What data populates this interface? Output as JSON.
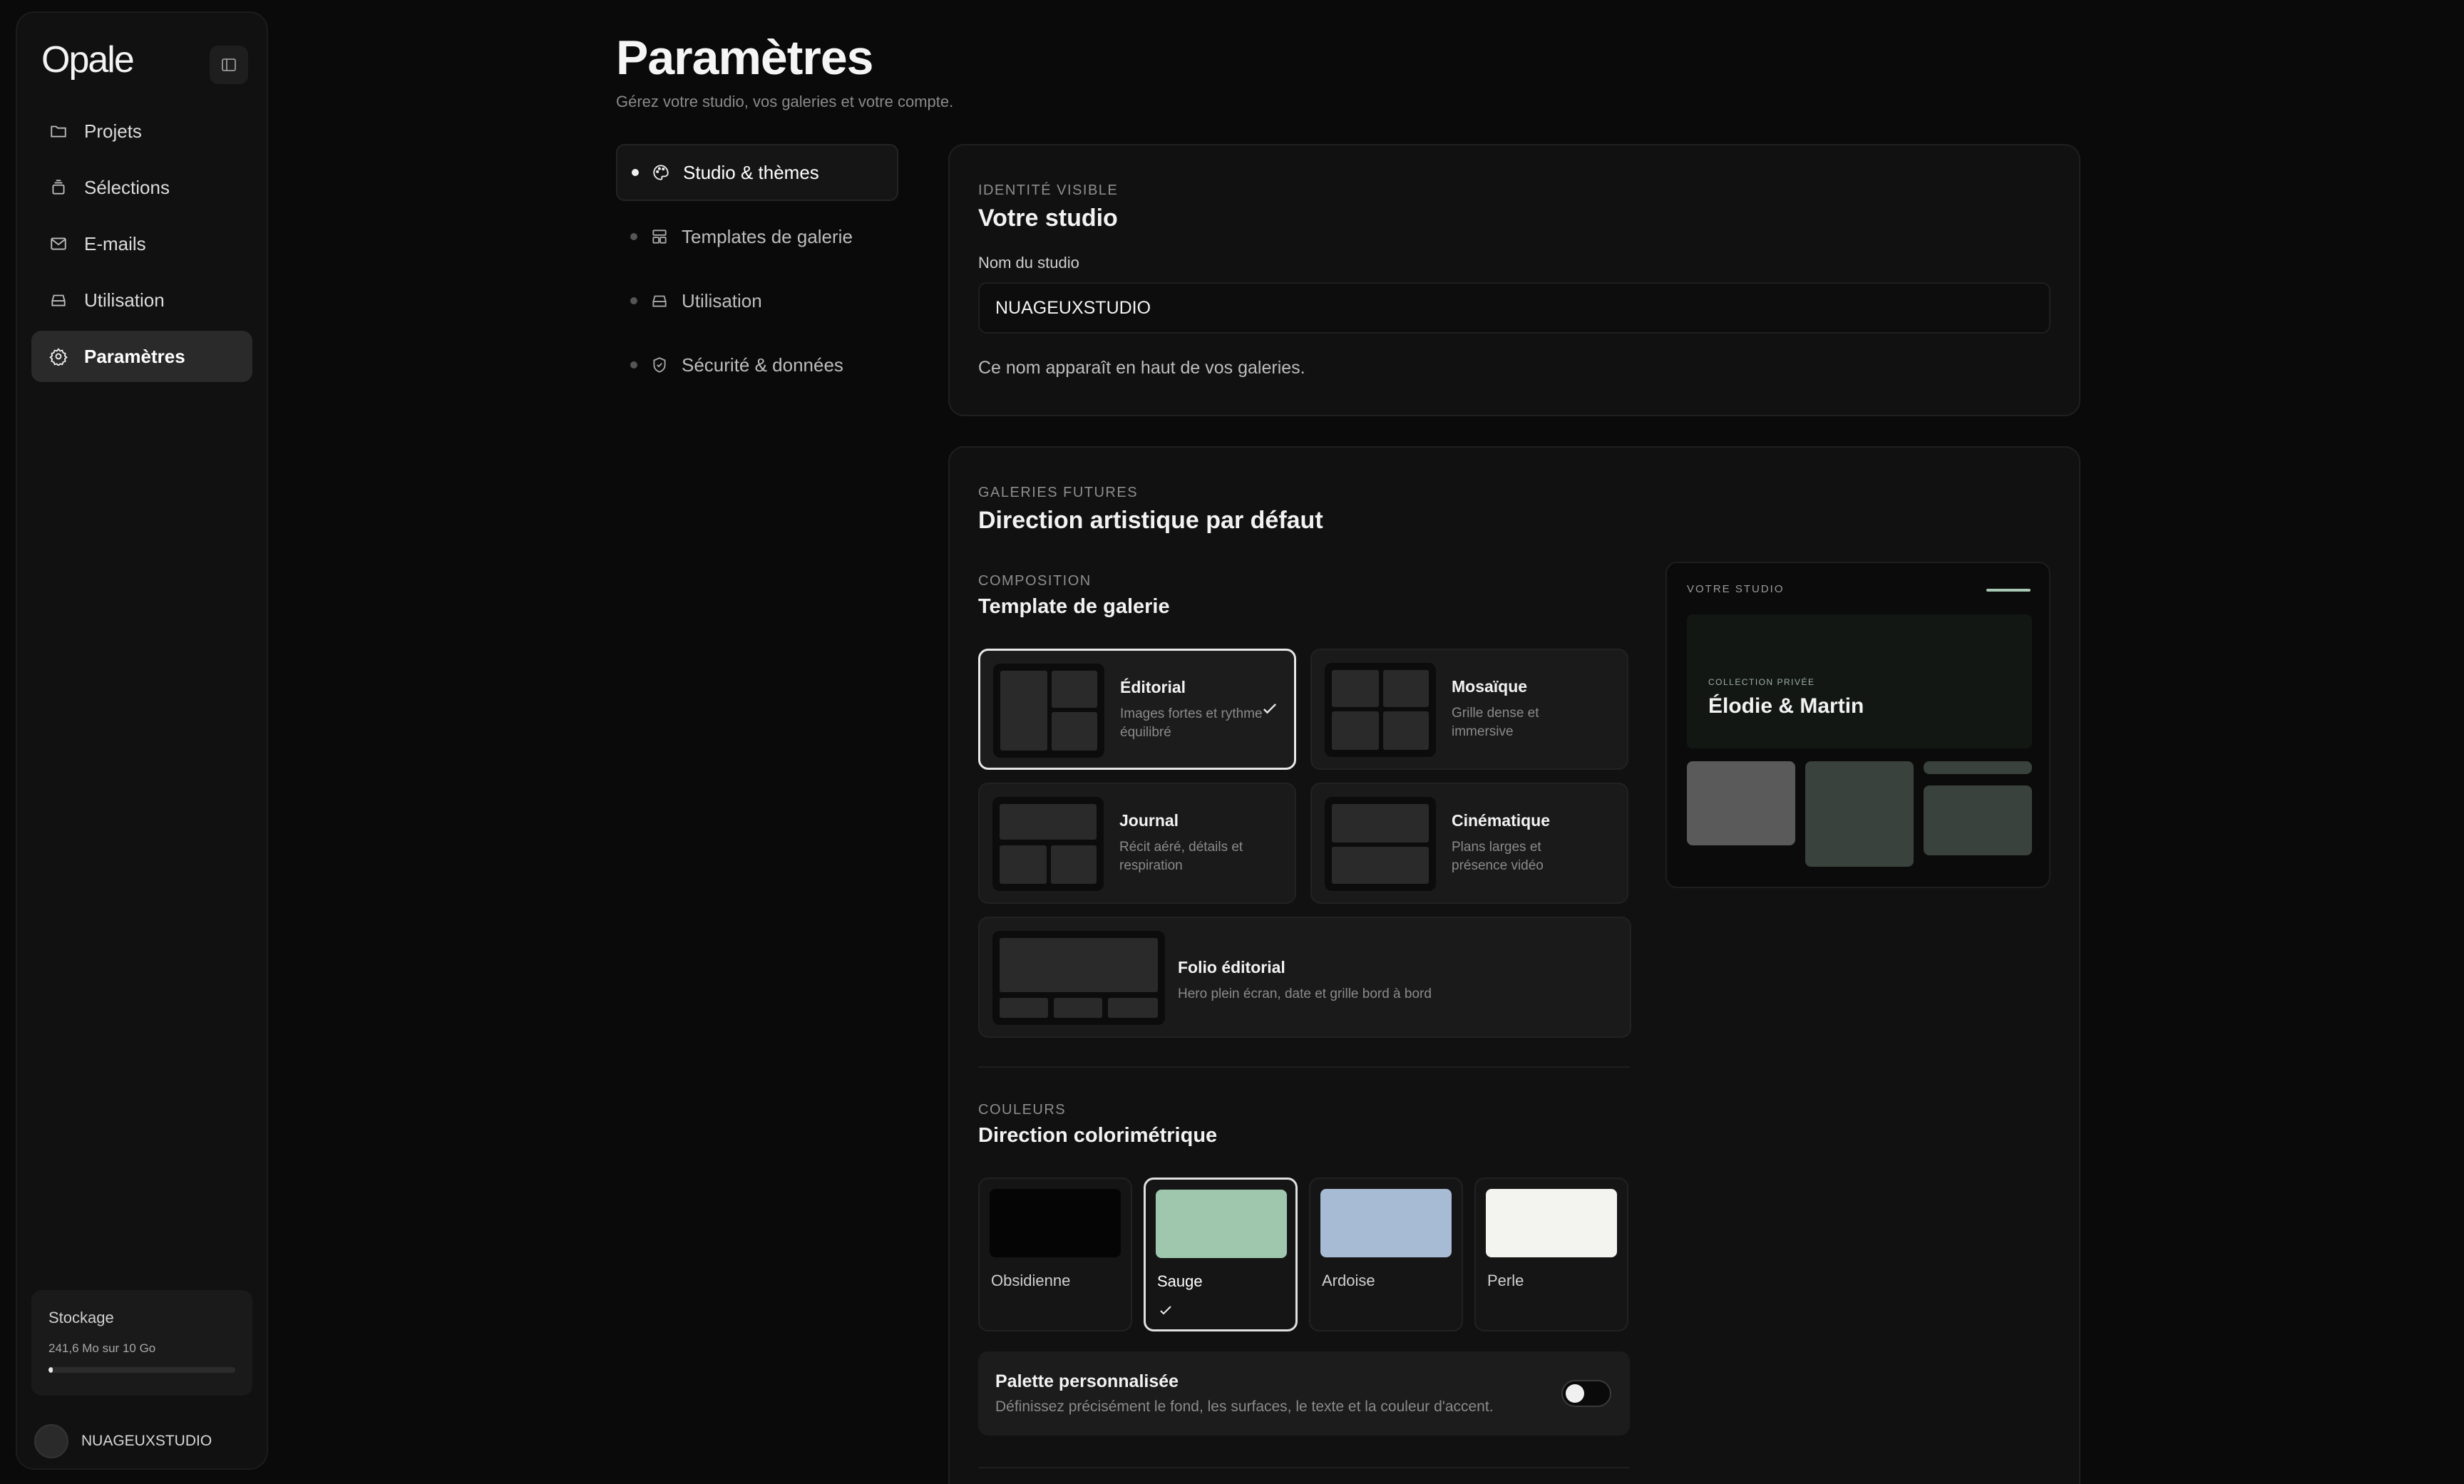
{
  "app": {
    "logo": "Opale"
  },
  "sidebar": {
    "items": [
      {
        "label": "Projets",
        "icon": "folder-icon",
        "active": false
      },
      {
        "label": "Sélections",
        "icon": "stack-icon",
        "active": false
      },
      {
        "label": "E-mails",
        "icon": "mail-icon",
        "active": false
      },
      {
        "label": "Utilisation",
        "icon": "drive-icon",
        "active": false
      },
      {
        "label": "Paramètres",
        "icon": "gear-icon",
        "active": true
      }
    ],
    "storage": {
      "title": "Stockage",
      "used": "241,6 Mo sur 10 Go",
      "fraction": 0.024
    },
    "user": {
      "name": "NUAGEUXSTUDIO"
    }
  },
  "header": {
    "title": "Paramètres",
    "subtitle": "Gérez votre studio, vos galeries et votre compte."
  },
  "subnav": {
    "items": [
      {
        "label": "Studio & thèmes",
        "icon": "palette-icon",
        "active": true
      },
      {
        "label": "Templates de galerie",
        "icon": "layout-icon",
        "active": false
      },
      {
        "label": "Utilisation",
        "icon": "drive-icon",
        "active": false
      },
      {
        "label": "Sécurité & données",
        "icon": "shield-icon",
        "active": false
      }
    ]
  },
  "identity": {
    "eyebrow": "IDENTITÉ VISIBLE",
    "title": "Votre studio",
    "field_label": "Nom du studio",
    "field_value": "NUAGEUXSTUDIO",
    "help": "Ce nom apparaît en haut de vos galeries."
  },
  "defaults": {
    "eyebrow": "GALERIES FUTURES",
    "title": "Direction artistique par défaut",
    "composition": {
      "eyebrow": "COMPOSITION",
      "title": "Template de galerie",
      "templates": [
        {
          "name": "Éditorial",
          "desc": "Images fortes et rythme équilibré",
          "selected": true
        },
        {
          "name": "Mosaïque",
          "desc": "Grille dense et immersive",
          "selected": false
        },
        {
          "name": "Journal",
          "desc": "Récit aéré, détails et respiration",
          "selected": false
        },
        {
          "name": "Cinématique",
          "desc": "Plans larges et présence vidéo",
          "selected": false
        },
        {
          "name": "Folio éditorial",
          "desc": "Hero plein écran, date et grille bord à bord",
          "selected": false
        }
      ]
    },
    "colors": {
      "eyebrow": "COULEURS",
      "title": "Direction colorimétrique",
      "swatches": [
        {
          "name": "Obsidienne",
          "color": "#050505",
          "selected": false
        },
        {
          "name": "Sauge",
          "color": "#9fc7ae",
          "selected": true
        },
        {
          "name": "Ardoise",
          "color": "#a8bbd4",
          "selected": false
        },
        {
          "name": "Perle",
          "color": "#f3f3f0",
          "selected": false
        }
      ]
    },
    "palette": {
      "title": "Palette personnalisée",
      "desc": "Définissez précisément le fond, les surfaces, le texte et la couleur d'accent.",
      "enabled": false
    },
    "preview": {
      "brand": "VOTRE STUDIO",
      "eyebrow": "COLLECTION PRIVÉE",
      "name": "Élodie & Martin",
      "accent": "#a7c8b2"
    }
  }
}
